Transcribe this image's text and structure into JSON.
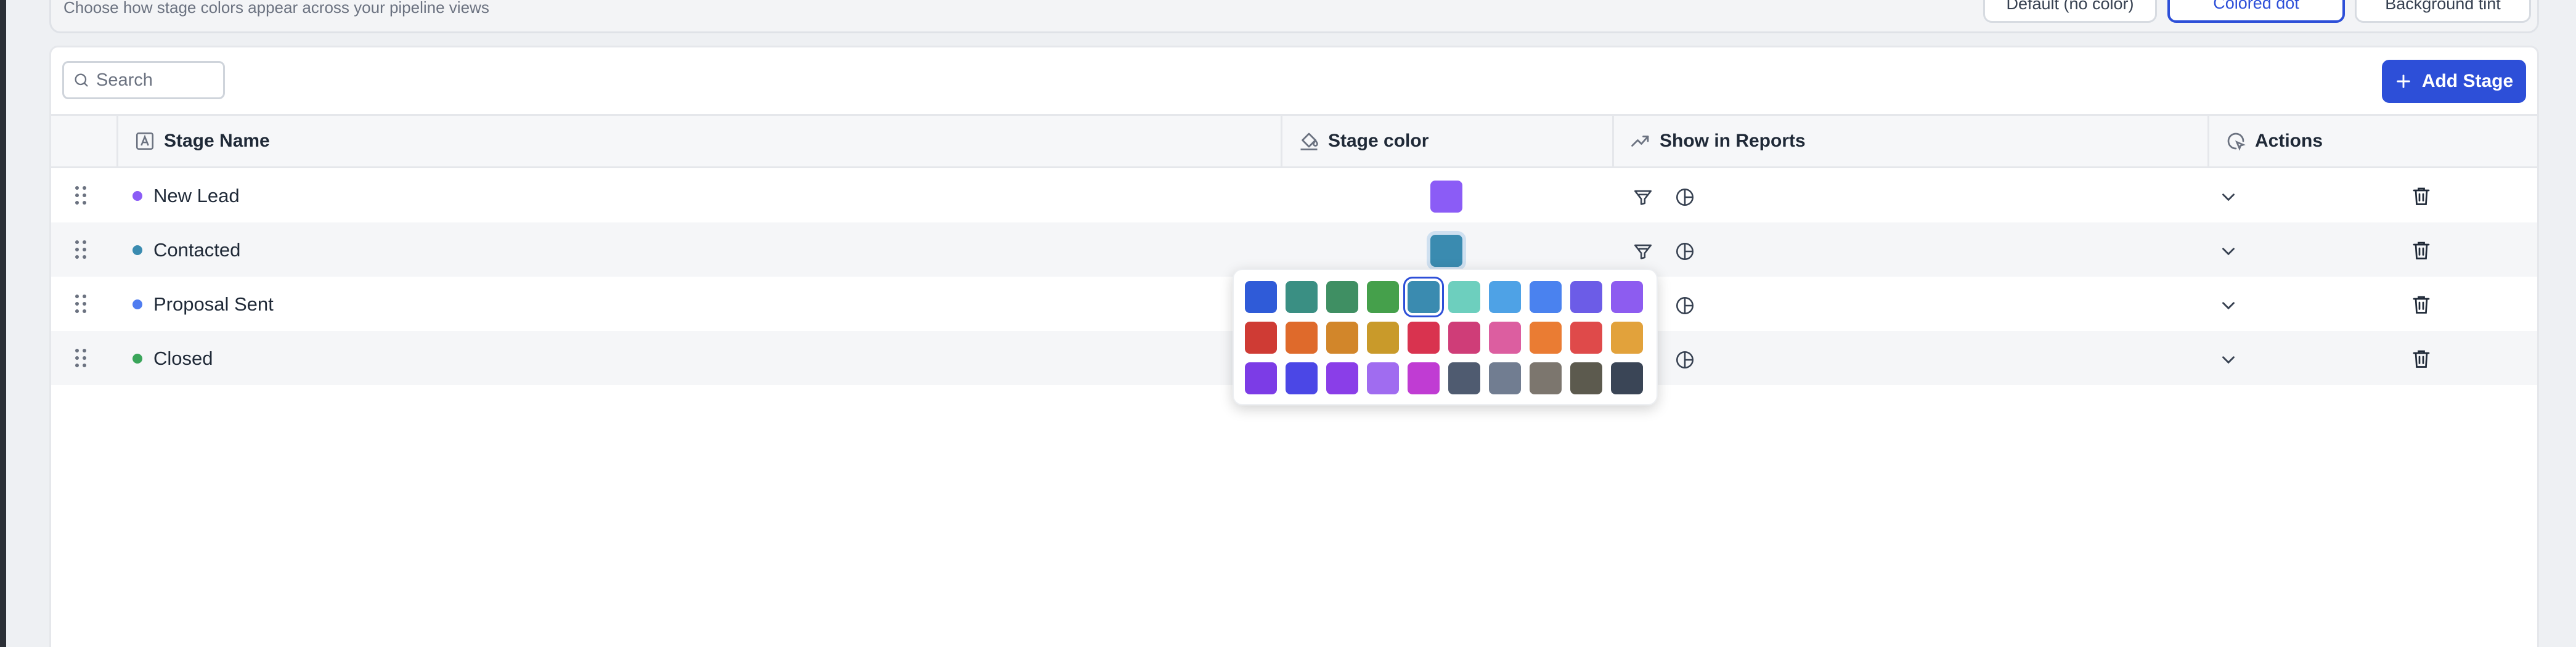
{
  "settings": {
    "subtitle": "Choose how stage colors appear across your pipeline views",
    "modes": [
      "Default (no color)",
      "Colored dot",
      "Background tint"
    ],
    "active_mode": "Colored dot"
  },
  "toolbar": {
    "search_placeholder": "Search",
    "add_stage_label": "Add Stage"
  },
  "table": {
    "columns": {
      "stage_name": "Stage Name",
      "stage_color": "Stage color",
      "show_in_reports": "Show in Reports",
      "actions": "Actions"
    },
    "rows": [
      {
        "name": "New Lead",
        "color": "#8b5cf6"
      },
      {
        "name": "Contacted",
        "color": "#3a8bb0"
      },
      {
        "name": "Proposal Sent",
        "color": "#4f7cf0"
      },
      {
        "name": "Closed",
        "color": "#3aa55a"
      }
    ]
  },
  "palette": {
    "selected_color": "#3a8bb0",
    "rows": [
      [
        "#2f5bd8",
        "#3a8f83",
        "#3f8f63",
        "#45a04b",
        "#3a8bb0",
        "#6dcfbe",
        "#4ea2e6",
        "#4a82ef",
        "#6c5ce7",
        "#8d5cf0"
      ],
      [
        "#cf3b34",
        "#df6a2b",
        "#d2862a",
        "#c99a2a",
        "#d9334f",
        "#cf3d78",
        "#dc5ea0",
        "#ea7c33",
        "#df4a4a",
        "#e2a23b"
      ],
      [
        "#7c3ce6",
        "#4b47e6",
        "#8a3ee8",
        "#a06cf0",
        "#c03cd3",
        "#4f5b70",
        "#717d91",
        "#7c766e",
        "#5c5a4e",
        "#3a4556"
      ]
    ]
  },
  "colors": {
    "primary": "#2d4fd8",
    "border": "#e5e7eb",
    "row_alt": "#f5f6f8"
  }
}
